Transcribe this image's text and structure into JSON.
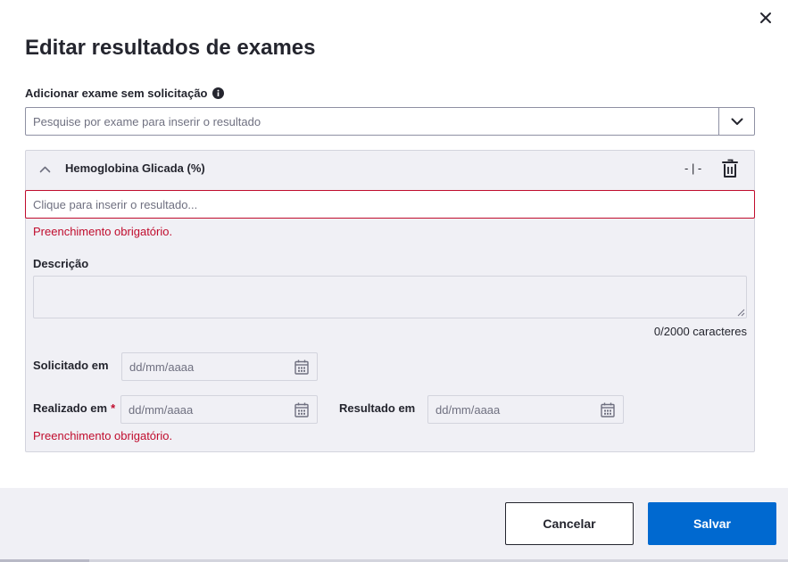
{
  "modal": {
    "title": "Editar resultados de exames",
    "close_icon": "close-icon"
  },
  "add_exam": {
    "label": "Adicionar exame sem solicitação",
    "info_icon": "info-icon",
    "search_placeholder": "Pesquise por exame para inserir o resultado",
    "dropdown_icon": "chevron-down-icon"
  },
  "exam": {
    "name": "Hemoglobina Glicada (%)",
    "reference": "- | -",
    "collapse_icon": "chevron-up-icon",
    "delete_icon": "trash-icon",
    "result_placeholder": "Clique para inserir o resultado...",
    "result_error": "Preenchimento obrigatório.",
    "description_label": "Descrição",
    "description_counter": "0/2000 caracteres",
    "requested_label": "Solicitado em",
    "performed_label": "Realizado em",
    "required_mark": "*",
    "result_date_label": "Resultado em",
    "date_placeholder": "dd/mm/aaaa",
    "date_error": "Preenchimento obrigatório."
  },
  "footer": {
    "cancel_label": "Cancelar",
    "save_label": "Salvar"
  },
  "colors": {
    "primary": "#0069d0",
    "error": "#c00c2d",
    "text": "#24252e",
    "panel_bg": "#f0f0f5"
  }
}
